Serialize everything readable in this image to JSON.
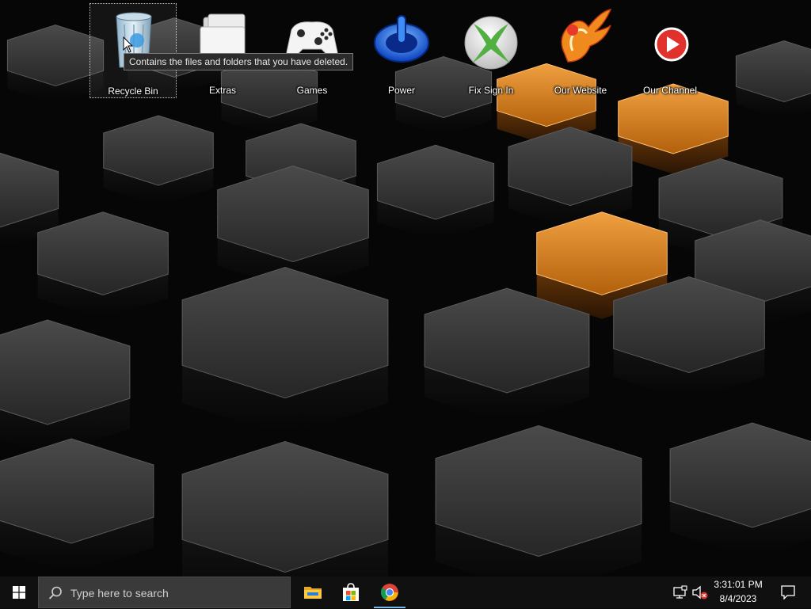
{
  "desktop": {
    "icons": [
      {
        "label": "Recycle Bin",
        "icon": "recycle-bin-icon"
      },
      {
        "label": "Extras",
        "icon": "folder-icon"
      },
      {
        "label": "Games",
        "icon": "xbox-controller-icon"
      },
      {
        "label": "Power",
        "icon": "power-icon"
      },
      {
        "label": "Fix Sign In",
        "icon": "xbox-logo-icon"
      },
      {
        "label": "Our Website",
        "icon": "phoenix-logo-icon"
      },
      {
        "label": "Our Channel",
        "icon": "youtube-play-icon"
      }
    ],
    "tooltip": "Contains the files and folders that you have deleted.",
    "accent_color": "#e8891a"
  },
  "taskbar": {
    "search_placeholder": "Type here to search",
    "pinned": [
      {
        "name": "File Explorer",
        "icon": "file-explorer-icon"
      },
      {
        "name": "Microsoft Store",
        "icon": "store-icon"
      },
      {
        "name": "Google Chrome",
        "icon": "chrome-icon"
      }
    ],
    "clock_time": "3:31:01 PM",
    "clock_date": "8/4/2023"
  }
}
